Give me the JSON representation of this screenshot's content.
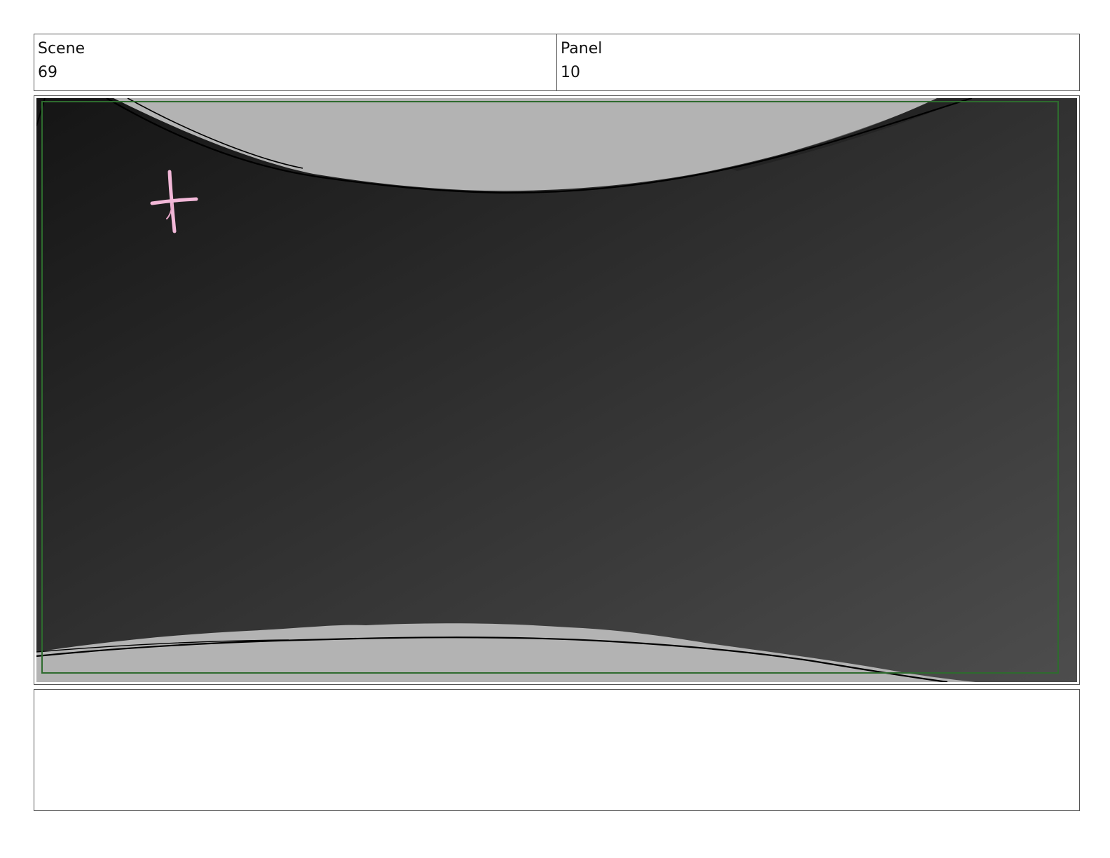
{
  "header": {
    "scene_label": "Scene",
    "scene_value": "69",
    "panel_label": "Panel",
    "panel_value": "10"
  },
  "panel": {
    "background_top_color": "#151515",
    "background_bottom_color": "#4d4d4d",
    "arc_fill_color": "#b3b3b3",
    "safe_frame_color": "#2e6b2e",
    "mark_color": "#f2b8d8",
    "mark_icon": "cross-mark-icon"
  },
  "notes": {
    "text": ""
  }
}
